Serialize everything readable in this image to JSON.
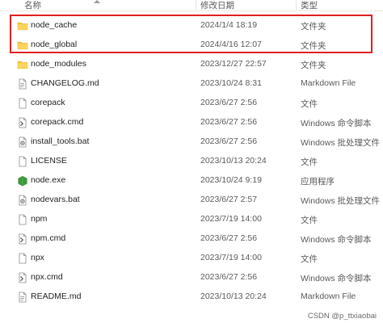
{
  "header": {
    "name_label": "名称",
    "date_label": "修改日期",
    "type_label": "类型"
  },
  "files": [
    {
      "name": "node_cache",
      "date": "2024/1/4 18:19",
      "type": "文件夹",
      "icon": "folder-icon"
    },
    {
      "name": "node_global",
      "date": "2024/4/16 12:07",
      "type": "文件夹",
      "icon": "folder-icon"
    },
    {
      "name": "node_modules",
      "date": "2023/12/27 22:57",
      "type": "文件夹",
      "icon": "folder-icon"
    },
    {
      "name": "CHANGELOG.md",
      "date": "2023/10/24 8:31",
      "type": "Markdown File",
      "icon": "markdown-file-icon"
    },
    {
      "name": "corepack",
      "date": "2023/6/27 2:56",
      "type": "文件",
      "icon": "file-icon"
    },
    {
      "name": "corepack.cmd",
      "date": "2023/6/27 2:56",
      "type": "Windows 命令脚本",
      "icon": "cmd-script-icon"
    },
    {
      "name": "install_tools.bat",
      "date": "2023/6/27 2:56",
      "type": "Windows 批处理文件",
      "icon": "batch-file-icon"
    },
    {
      "name": "LICENSE",
      "date": "2023/10/13 20:24",
      "type": "文件",
      "icon": "file-icon"
    },
    {
      "name": "node.exe",
      "date": "2023/10/24 9:19",
      "type": "应用程序",
      "icon": "node-exe-icon"
    },
    {
      "name": "nodevars.bat",
      "date": "2023/6/27 2:57",
      "type": "Windows 批处理文件",
      "icon": "batch-file-icon"
    },
    {
      "name": "npm",
      "date": "2023/7/19 14:00",
      "type": "文件",
      "icon": "file-icon"
    },
    {
      "name": "npm.cmd",
      "date": "2023/6/27 2:56",
      "type": "Windows 命令脚本",
      "icon": "cmd-script-icon"
    },
    {
      "name": "npx",
      "date": "2023/7/19 14:00",
      "type": "文件",
      "icon": "file-icon"
    },
    {
      "name": "npx.cmd",
      "date": "2023/6/27 2:56",
      "type": "Windows 命令脚本",
      "icon": "cmd-script-icon"
    },
    {
      "name": "README.md",
      "date": "2023/10/13 20:24",
      "type": "Markdown File",
      "icon": "markdown-file-icon"
    }
  ],
  "highlight_color": "#e02020",
  "watermark": "CSDN @p_ttxiaobai"
}
